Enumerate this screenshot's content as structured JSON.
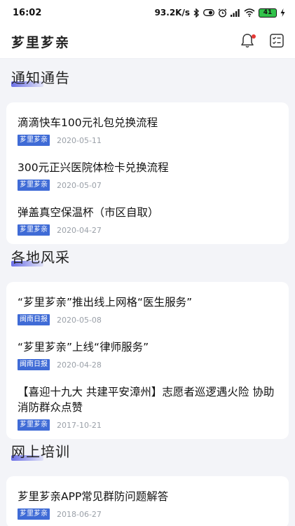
{
  "status_bar": {
    "time": "16:02",
    "net_speed": "93.2K/s",
    "battery": "41"
  },
  "header": {
    "title": "芗里芗亲"
  },
  "sections": [
    {
      "title": "通知通告",
      "items": [
        {
          "title": "滴滴快车100元礼包兑换流程",
          "tag": "芗里芗亲",
          "date": "2020-05-11"
        },
        {
          "title": "300元正兴医院体检卡兑换流程",
          "tag": "芗里芗亲",
          "date": "2020-05-07"
        },
        {
          "title": "弹盖真空保温杯（市区自取）",
          "tag": "芗里芗亲",
          "date": "2020-04-27"
        }
      ]
    },
    {
      "title": "各地风采",
      "items": [
        {
          "title": "“芗里芗亲”推出线上网格“医生服务”",
          "tag": "闽南日报",
          "date": "2020-05-08"
        },
        {
          "title": "“芗里芗亲”上线“律师服务”",
          "tag": "闽南日报",
          "date": "2020-04-28"
        },
        {
          "title": "【喜迎十九大 共建平安漳州】志愿者巡逻遇火险 协助消防群众点赞",
          "tag": "芗里芗亲",
          "date": "2017-10-21"
        }
      ]
    },
    {
      "title": "网上培训",
      "items": [
        {
          "title": "芗里芗亲APP常见群防问题解答",
          "tag": "芗里芗亲",
          "date": "2018-06-27"
        }
      ]
    }
  ],
  "icons": {
    "bell": "bell-icon",
    "checklist": "checklist-icon",
    "bluetooth": "bluetooth-icon",
    "alarm": "alarm-icon",
    "wifi": "wifi-icon"
  },
  "colors": {
    "tag_bg": "#3f6bd6",
    "accent_underline": "#6b6fe6",
    "notification_dot": "#e53935",
    "battery_fill": "#31c24a"
  }
}
